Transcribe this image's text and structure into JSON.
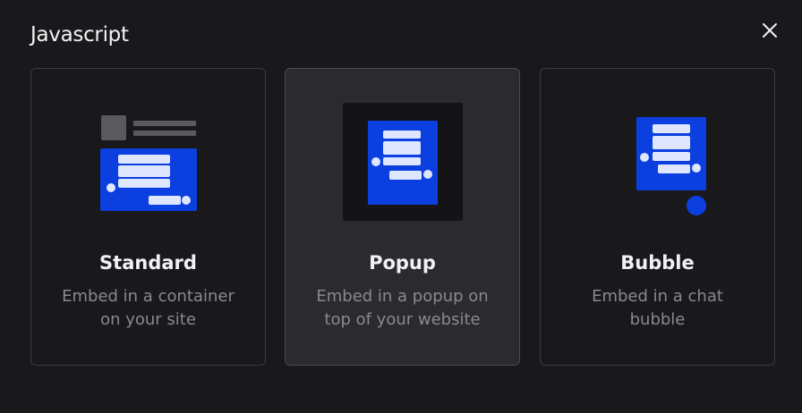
{
  "dialog": {
    "title": "Javascript"
  },
  "options": [
    {
      "title": "Standard",
      "description": [
        "Embed in a container",
        "on your site"
      ],
      "selected": false
    },
    {
      "title": "Popup",
      "description": [
        "Embed in a popup on",
        "top of your website"
      ],
      "selected": true
    },
    {
      "title": "Bubble",
      "description": [
        "Embed in a chat",
        "bubble"
      ],
      "selected": false
    }
  ],
  "icons": {
    "close": "close-icon",
    "standard": "standard-embed-icon",
    "popup": "popup-embed-icon",
    "bubble": "bubble-embed-icon"
  },
  "colors": {
    "background": "#19181b",
    "card_selected": "#2b2a2e",
    "accent_blue": "#0b3fe0",
    "bubble_line": "#dfe6ff",
    "title_text": "#f1f1f3",
    "muted_text": "#8a898e"
  }
}
